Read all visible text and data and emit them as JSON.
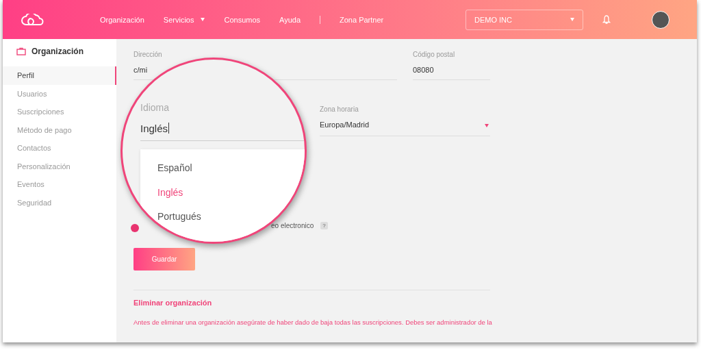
{
  "header": {
    "nav": [
      {
        "label": "Organización",
        "has_caret": false,
        "separator_before": false
      },
      {
        "label": "Servicios",
        "has_caret": true,
        "separator_before": false
      },
      {
        "label": "Consumos",
        "has_caret": false,
        "separator_before": false
      },
      {
        "label": "Ayuda",
        "has_caret": false,
        "separator_before": false
      },
      {
        "label": "Zona Partner",
        "has_caret": false,
        "separator_before": true
      }
    ],
    "account_selector": {
      "value": "DEMO INC"
    }
  },
  "sidebar": {
    "title": "Organización",
    "items": [
      {
        "label": "Perfil",
        "selected": true
      },
      {
        "label": "Usuarios",
        "selected": false
      },
      {
        "label": "Suscripciones",
        "selected": false
      },
      {
        "label": "Método de pago",
        "selected": false
      },
      {
        "label": "Contactos",
        "selected": false
      },
      {
        "label": "Personalización",
        "selected": false
      },
      {
        "label": "Eventos",
        "selected": false
      },
      {
        "label": "Seguridad",
        "selected": false
      }
    ]
  },
  "form": {
    "address": {
      "label": "Dirección",
      "value": "c/mi"
    },
    "postal_code": {
      "label": "Código postal",
      "value": "08080"
    },
    "timezone": {
      "label": "Zona horaria",
      "value": "Europa/Madrid"
    },
    "email_option": {
      "label": "eo electronico",
      "checked": true,
      "help": "?"
    },
    "save_button": "Guardar"
  },
  "danger_zone": {
    "title": "Eliminar organización",
    "text": "Antes de eliminar una organización asegúrate de haber dado de baja todas las suscripciones. Debes ser administrador de la"
  },
  "magnifier": {
    "field": {
      "label": "Idioma",
      "value": "Inglés"
    },
    "options": [
      {
        "label": "Español",
        "selected": false
      },
      {
        "label": "Inglés",
        "selected": true
      },
      {
        "label": "Portugués",
        "selected": false
      }
    ]
  }
}
